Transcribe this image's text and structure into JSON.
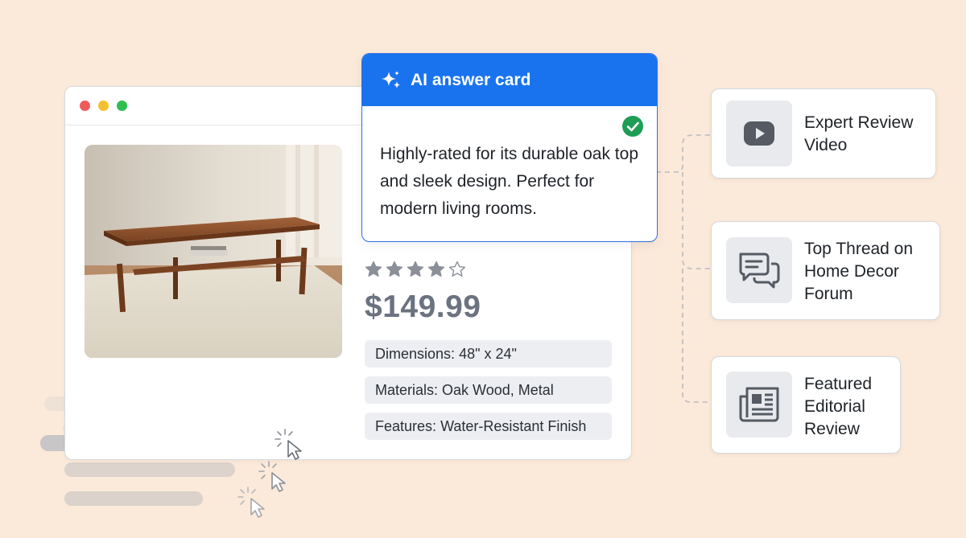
{
  "ai_card": {
    "title": "AI answer card",
    "body": "Highly-rated for its durable oak top and sleek design. Perfect for modern living rooms."
  },
  "product": {
    "rating": 4,
    "rating_max": 5,
    "price": "$149.99",
    "specs": [
      {
        "label": "Dimensions:",
        "value": "48\" x 24\""
      },
      {
        "label": "Materials:",
        "value": "Oak Wood, Metal"
      },
      {
        "label": "Features:",
        "value": "Water-Resistant Finish"
      }
    ]
  },
  "sources": [
    {
      "icon": "video-play-icon",
      "label": "Expert Review Video"
    },
    {
      "icon": "chat-bubbles-icon",
      "label": "Top Thread on Home Decor Forum"
    },
    {
      "icon": "newspaper-icon",
      "label": "Featured Editorial Review"
    }
  ],
  "colors": {
    "background": "#fbe9d9",
    "accent": "#1a73ee",
    "check": "#1e9e55",
    "window_red": "#ef5b5b",
    "window_yellow": "#f5c02e",
    "window_green": "#2fbf4f"
  }
}
